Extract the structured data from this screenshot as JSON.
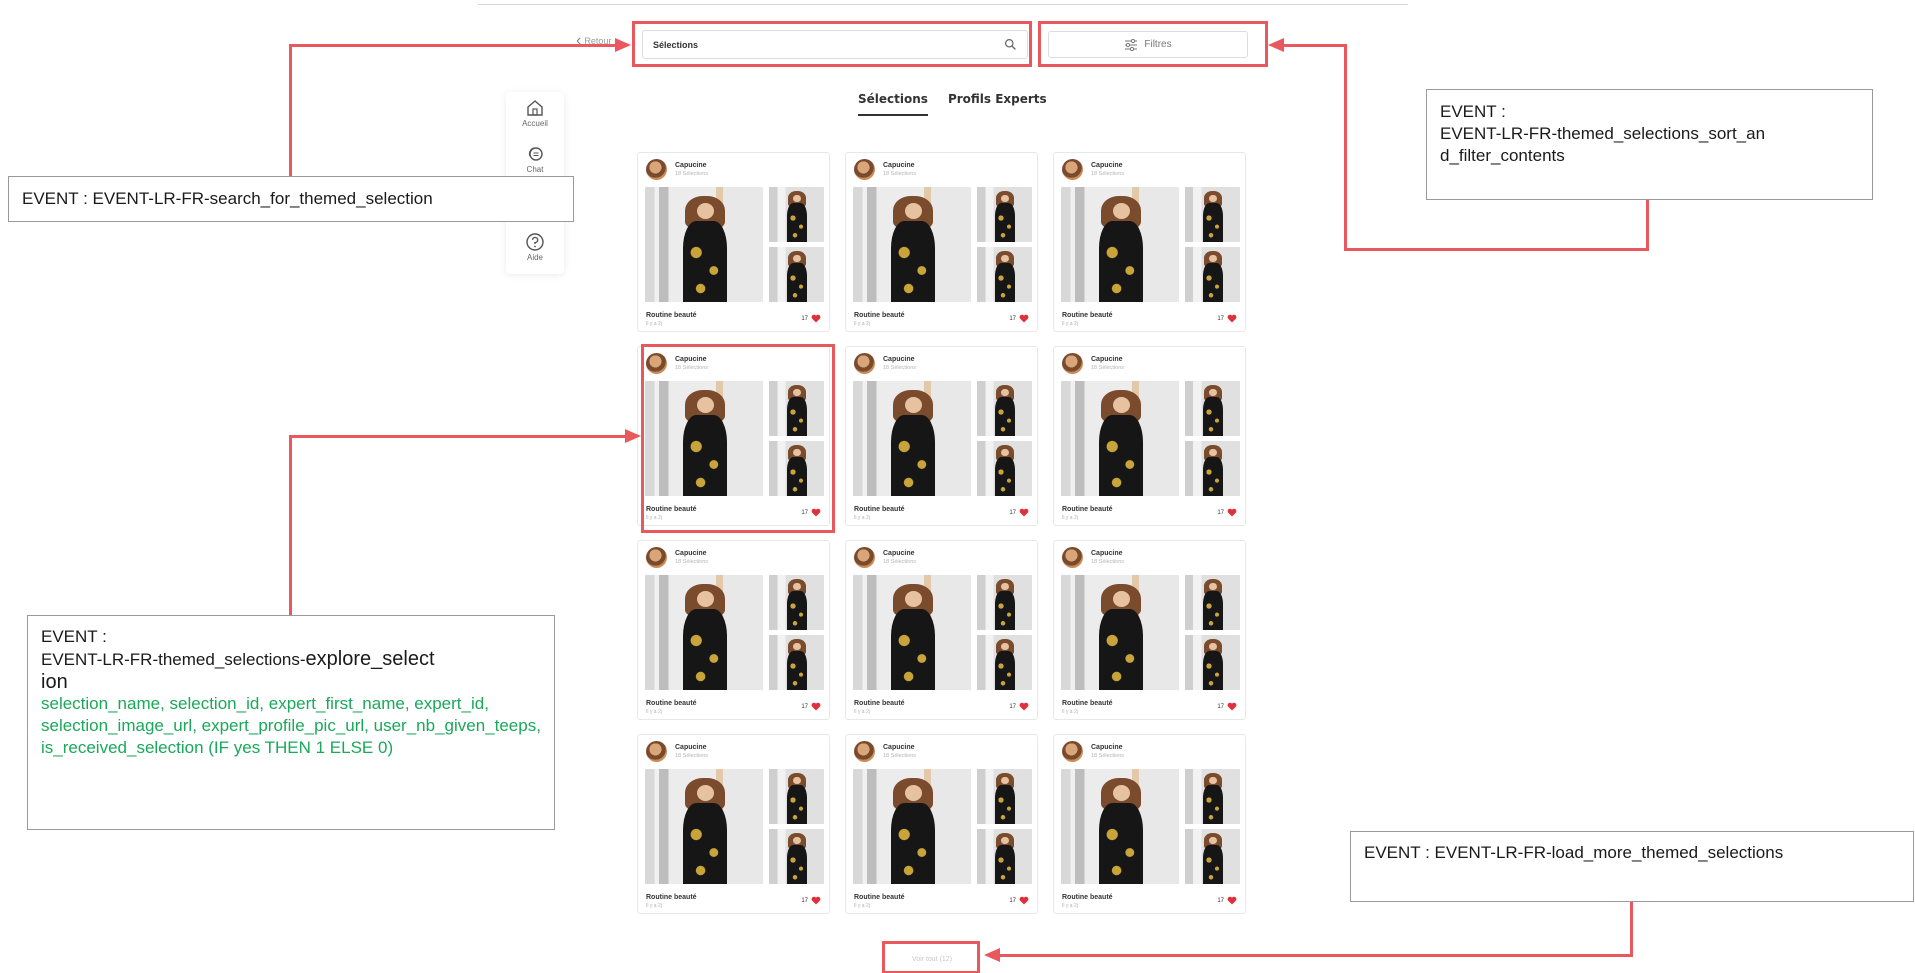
{
  "header": {
    "back_label": "Retour",
    "search_value": "Sélections",
    "filter_label": "Filtres"
  },
  "tabs": [
    {
      "label": "Sélections",
      "active": true
    },
    {
      "label": "Profils Experts",
      "active": false
    }
  ],
  "sidenav": {
    "items": [
      {
        "label": "Accueil",
        "icon": "home-icon"
      },
      {
        "label": "Chat",
        "icon": "chat-icon"
      },
      {
        "label": "Aide",
        "icon": "help-icon"
      }
    ]
  },
  "cards": {
    "expert_name": "Capucine",
    "expert_sub": "18 Sélections",
    "selection_title": "Routine beauté",
    "date": "Il y a 2j",
    "likes": "17",
    "count": 12
  },
  "load_more_label": "Voir tout (12)",
  "annotations": {
    "search": "EVENT : EVENT-LR-FR-search_for_themed_selection",
    "filter_line1": "EVENT :",
    "filter_line2": "EVENT-LR-FR-themed_selections_sort_an",
    "filter_line3": "d_filter_contents",
    "explore_line1": "EVENT :",
    "explore_prefix": "EVENT-LR-FR-themed_selections-",
    "explore_suffix": "explore_select",
    "explore_suffix2": "ion",
    "explore_params": "selection_name, selection_id, expert_first_name, expert_id, selection_image_url, expert_profile_pic_url, user_nb_given_teeps, is_received_selection (IF yes THEN 1 ELSE 0)",
    "load_more": "EVENT : EVENT-LR-FR-load_more_themed_selections"
  },
  "colors": {
    "annotation": "#e8585c",
    "params_text": "#1aa85a",
    "heart": "#e0303a"
  }
}
